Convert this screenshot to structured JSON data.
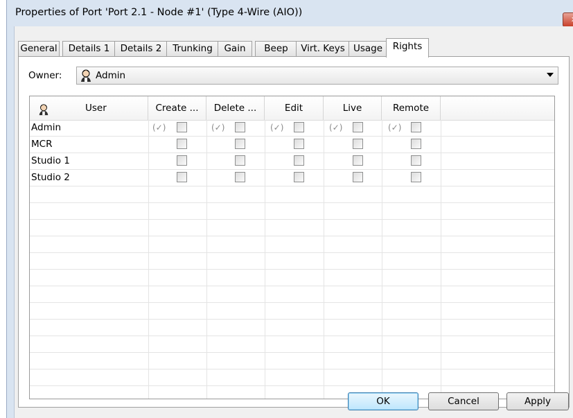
{
  "window": {
    "title": "Properties of Port 'Port 2.1 - Node #1' (Type 4-Wire (AIO))",
    "close_glyph": "x"
  },
  "tabs": [
    {
      "label": "General",
      "active": false
    },
    {
      "label": "Details 1",
      "active": false
    },
    {
      "label": "Details 2",
      "active": false
    },
    {
      "label": "Trunking",
      "active": false
    },
    {
      "label": "Gain",
      "active": false
    },
    {
      "label": "Beep",
      "active": false
    },
    {
      "label": "Virt. Keys",
      "active": false
    },
    {
      "label": "Usage",
      "active": false
    },
    {
      "label": "Rights",
      "active": true
    }
  ],
  "owner": {
    "label": "Owner:",
    "value": "Admin",
    "icon": "person-icon"
  },
  "grid": {
    "columns": [
      "User",
      "Create ...",
      "Delete ...",
      "Edit",
      "Live",
      "Remote"
    ],
    "header_icon": "person-icon",
    "rows": [
      {
        "user": "Admin",
        "inherited": [
          true,
          true,
          true,
          true,
          true
        ],
        "checked": [
          false,
          false,
          false,
          false,
          false
        ]
      },
      {
        "user": "MCR",
        "inherited": [
          false,
          false,
          false,
          false,
          false
        ],
        "checked": [
          false,
          false,
          false,
          false,
          false
        ]
      },
      {
        "user": "Studio 1",
        "inherited": [
          false,
          false,
          false,
          false,
          false
        ],
        "checked": [
          false,
          false,
          false,
          false,
          false
        ]
      },
      {
        "user": "Studio 2",
        "inherited": [
          false,
          false,
          false,
          false,
          false
        ],
        "checked": [
          false,
          false,
          false,
          false,
          false
        ]
      }
    ],
    "tick_glyph": "(✓)"
  },
  "buttons": {
    "ok": "OK",
    "cancel": "Cancel",
    "apply": "Apply"
  }
}
